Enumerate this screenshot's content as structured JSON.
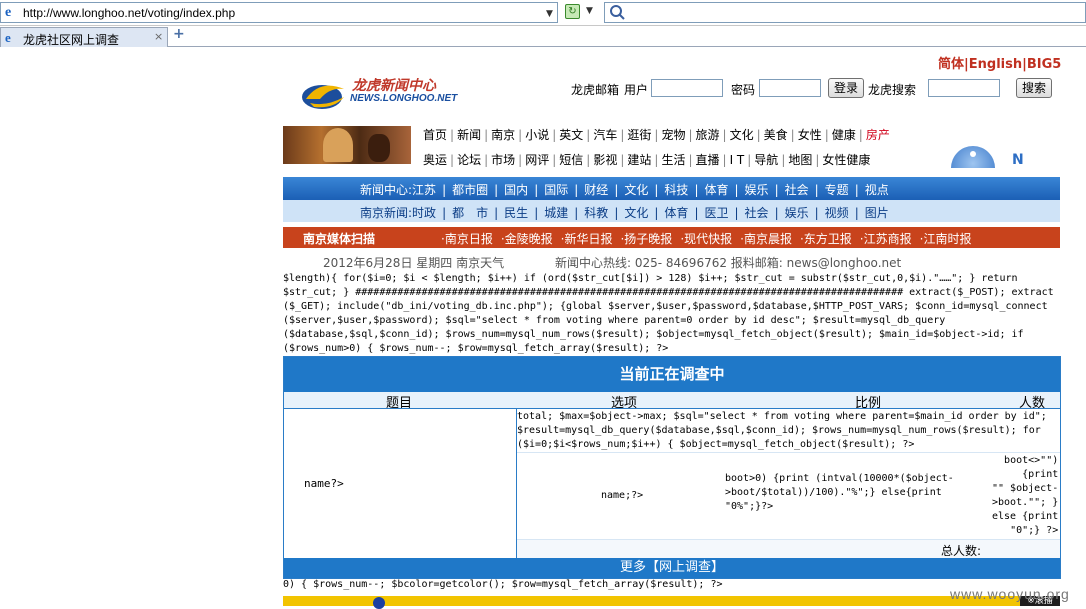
{
  "browser": {
    "url": "http://www.longhoo.net/voting/index.php",
    "tab_title": "龙虎社区网上调查",
    "tab_close": "×",
    "new_tab": "+"
  },
  "header": {
    "lang_simplified": "简体",
    "lang_english": "English",
    "lang_big5": "BIG5",
    "logo_cn": "龙虎新闻中心",
    "logo_en": "NEWS.LONGHOO.NET",
    "mail_label": "龙虎邮箱",
    "user_label": "用户",
    "password_label": "密码",
    "login_button": "登录",
    "search_label": "龙虎搜索",
    "search_button": "搜索"
  },
  "nav_row1": [
    "首页",
    "新闻",
    "南京",
    "小说",
    "英文",
    "汽车",
    "逛街",
    "宠物",
    "旅游",
    "文化",
    "美食",
    "女性",
    "健康",
    "房产"
  ],
  "nav_row2": [
    "奥运",
    "论坛",
    "市场",
    "网评",
    "短信",
    "影视",
    "建站",
    "生活",
    "直播",
    "I T",
    "导航",
    "地图",
    "女性健康"
  ],
  "bar1": {
    "label": "新闻中心:",
    "items": [
      "江苏",
      "都市圈",
      "国内",
      "国际",
      "财经",
      "文化",
      "科技",
      "体育",
      "娱乐",
      "社会",
      "专题",
      "视点"
    ]
  },
  "bar2": {
    "label": "南京新闻:",
    "items": [
      "时政",
      "都　市",
      "民生",
      "城建",
      "科教",
      "文化",
      "体育",
      "医卫",
      "社会",
      "娱乐",
      "视频",
      "图片"
    ]
  },
  "bar3": {
    "title": "南京媒体扫描",
    "items": [
      "·南京日报",
      "·金陵晚报",
      "·新华日报",
      "·扬子晚报",
      "·现代快报",
      "·南京晨报",
      "·东方卫报",
      "·江苏商报",
      "·江南时报"
    ]
  },
  "date_line": "2012年6月28日  星期四  南京天气",
  "hotline": "新闻中心热线: 025- 84696762 报料邮箱: news@longhoo.net",
  "code_lines": [
    "$length){ for($i=0; $i < $length; $i++) if (ord($str_cut[$i]) > 128) $i++; $str_cut = substr($str_cut,0,$i).\"……\"; } return",
    "$str_cut; } ########################################################################################### extract($_POST); extract",
    "($_GET); include(\"db_ini/voting_db.inc.php\"); {global $server,$user,$password,$database,$HTTP_POST_VARS; $conn_id=mysql_connect",
    "($server,$user,$password); $sql=\"select * from voting where parent=0 order by id desc\"; $result=mysql_db_query",
    "($database,$sql,$conn_id); $rows_num=mysql_num_rows($result); $object=mysql_fetch_object($result); $main_id=$object->id; if",
    "($rows_num>0) { $rows_num--; $row=mysql_fetch_array($result); ?>"
  ],
  "poll": {
    "title": "当前正在调查中",
    "col_topic": "题目",
    "col_option": "选项",
    "col_ratio": "比例",
    "col_count": "人数",
    "left_name": "name?>",
    "right_code": [
      "total; $max=$object->max; $sql=\"select * from voting where parent=$main_id order by id\";",
      "$result=mysql_db_query($database,$sql,$conn_id); $rows_num=mysql_num_rows($result); for",
      "($i=0;$i<$rows_num;$i++) { $object=mysql_fetch_object($result); ?>"
    ],
    "option_name": "name;?>",
    "ratio_code": [
      "boot>0) {print (intval(10000*($object-",
      ">boot/$total))/100).\"%\";} else{print",
      "\"0%\";}?>"
    ],
    "count_code": [
      "boot<>\"\")",
      "{print",
      "\"\" $object-",
      ">boot.\"\"; }",
      "else {print",
      "\"0\";} ?>"
    ],
    "total_label": "总人数:",
    "more": "更多【网上调查】"
  },
  "tail_code": "0) { $rows_num--; $bcolor=getcolor(); $row=mysql_fetch_array($result); ?>",
  "bottom_dark": "※滚播",
  "watermark": "www.wooyun.org"
}
